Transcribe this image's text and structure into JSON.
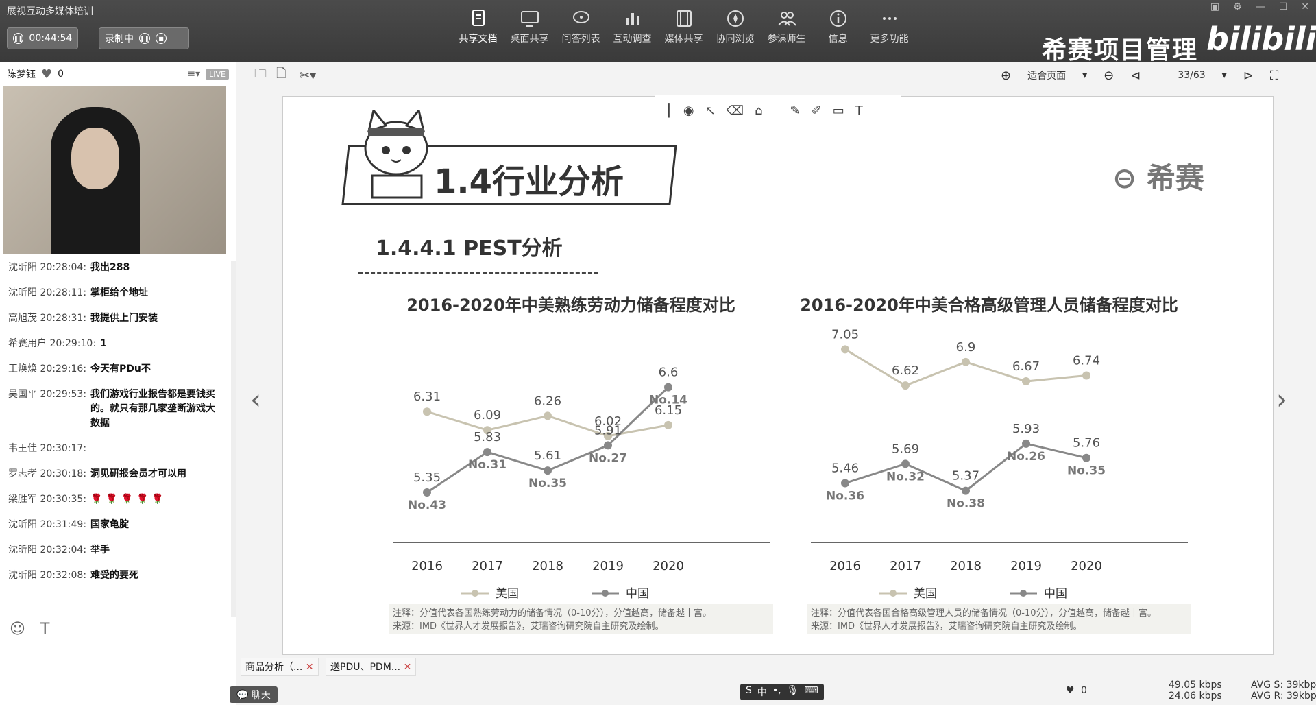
{
  "app": {
    "title": "展视互动多媒体培训",
    "timer": "00:44:54",
    "record_label": "录制中"
  },
  "toolbar": [
    {
      "label": "共享文档",
      "icon": "document-icon"
    },
    {
      "label": "桌面共享",
      "icon": "desktop-icon"
    },
    {
      "label": "问答列表",
      "icon": "chat-icon"
    },
    {
      "label": "互动调查",
      "icon": "chart-icon"
    },
    {
      "label": "媒体共享",
      "icon": "film-icon"
    },
    {
      "label": "协同浏览",
      "icon": "compass-icon"
    },
    {
      "label": "参课师生",
      "icon": "users-icon"
    },
    {
      "label": "信息",
      "icon": "info-icon"
    },
    {
      "label": "更多功能",
      "icon": "more-icon"
    }
  ],
  "brand": "希赛项目管理",
  "bilibili": "bilibili",
  "presenter": {
    "name": "陈梦钰",
    "likes": "0",
    "live": "LIVE"
  },
  "chat": [
    {
      "who": "沈昕阳",
      "time": "20:28:04:",
      "text": "我出288"
    },
    {
      "who": "沈昕阳",
      "time": "20:28:11:",
      "text": "掌柜给个地址"
    },
    {
      "who": "高旭茂",
      "time": "20:28:31:",
      "text": "我提供上门安装"
    },
    {
      "who": "希赛用户",
      "time": "20:29:10:",
      "text": "1"
    },
    {
      "who": "王焕焕",
      "time": "20:29:16:",
      "text": "今天有PDu不"
    },
    {
      "who": "吴国平",
      "time": "20:29:53:",
      "text": "我们游戏行业报告都是要钱买的。就只有那几家垄断游戏大数据"
    },
    {
      "who": "韦王佳",
      "time": "20:30:17:",
      "text": ""
    },
    {
      "who": "罗志孝",
      "time": "20:30:18:",
      "text": "洞见研报会员才可以用"
    },
    {
      "who": "梁胜军",
      "time": "20:30:35:",
      "text": "🌹 🌹 🌹 🌹 🌹"
    },
    {
      "who": "沈昕阳",
      "time": "20:31:49:",
      "text": "国家龟腚"
    },
    {
      "who": "沈昕阳",
      "time": "20:32:04:",
      "text": "举手"
    },
    {
      "who": "沈昕阳",
      "time": "20:32:08:",
      "text": "难受的要死"
    }
  ],
  "docbar": {
    "zoom": "适合页面",
    "page": "33/63"
  },
  "slide": {
    "title": "1.4行业分析",
    "logo": "希赛",
    "subtitle": "1.4.4.1 PEST分析"
  },
  "chart_data": [
    {
      "type": "line",
      "title": "2016-2020年中美熟练劳动力储备程度对比",
      "categories": [
        "2016",
        "2017",
        "2018",
        "2019",
        "2020"
      ],
      "series": [
        {
          "name": "美国",
          "values": [
            6.31,
            6.09,
            6.26,
            6.02,
            6.15
          ],
          "color": "#c8c3b0"
        },
        {
          "name": "中国",
          "values": [
            5.35,
            5.83,
            5.61,
            5.91,
            6.6
          ],
          "color": "#888888",
          "ranks": [
            "No.43",
            "No.31",
            "No.35",
            "No.27",
            "No.14"
          ]
        }
      ],
      "note1": "注释：分值代表各国熟练劳动力的储备情况（0-10分），分值越高，储备越丰富。",
      "note2": "来源：IMD《世界人才发展报告》，艾瑞咨询研究院自主研究及绘制。"
    },
    {
      "type": "line",
      "title": "2016-2020年中美合格高级管理人员储备程度对比",
      "categories": [
        "2016",
        "2017",
        "2018",
        "2019",
        "2020"
      ],
      "series": [
        {
          "name": "美国",
          "values": [
            7.05,
            6.62,
            6.9,
            6.67,
            6.74
          ],
          "color": "#c8c3b0"
        },
        {
          "name": "中国",
          "values": [
            5.46,
            5.69,
            5.37,
            5.93,
            5.76
          ],
          "color": "#888888",
          "ranks": [
            "No.36",
            "No.32",
            "No.38",
            "No.26",
            "No.35"
          ]
        }
      ],
      "note1": "注释：分值代表各国合格高级管理人员的储备情况（0-10分），分值越高，储备越丰富。",
      "note2": "来源：IMD《世界人才发展报告》，艾瑞咨询研究院自主研究及绘制。"
    }
  ],
  "bottom": {
    "tab1": "商品分析（...",
    "tab2": "送PDU、PDM...",
    "chat_tab": "聊天",
    "likes": "0",
    "up": "49.05 kbps",
    "down": "24.06 kbps",
    "avg_s": "AVG S: 39kbps",
    "avg_r": "AVG R: 39kbps"
  }
}
